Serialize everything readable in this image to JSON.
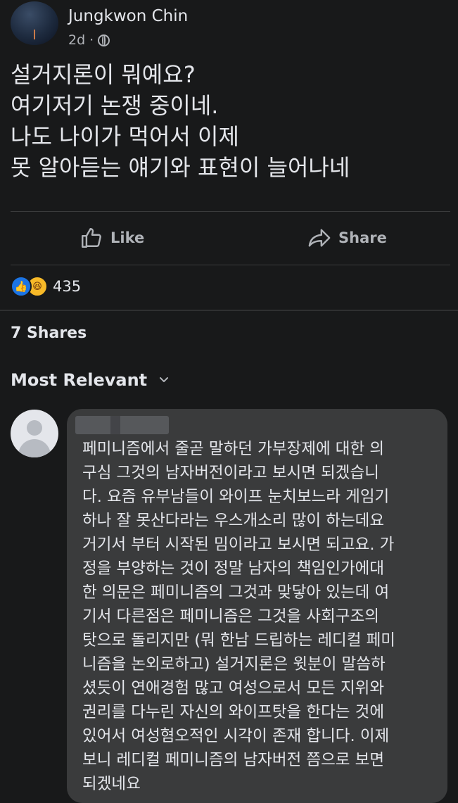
{
  "post": {
    "author": "Jungkwon Chin",
    "time": "2d",
    "privacy_icon": "globe-icon",
    "lines": [
      "설거지론이 뭐예요?",
      "여기저기 논쟁  중이네.",
      "나도 나이가 먹어서 이제",
      "못 알아듣는 얘기와 표현이 늘어나네"
    ]
  },
  "actions": {
    "like": "Like",
    "share": "Share"
  },
  "reactions": {
    "icons": [
      "like-icon",
      "haha-icon"
    ],
    "count": "435"
  },
  "shares": "7 Shares",
  "sort": {
    "label": "Most Relevant"
  },
  "comment": {
    "lines": [
      "페미니즘에서 줄곧 말하던 가부장제에 대한 의",
      "구심 그것의 남자버전이라고 보시면 되겠습니",
      "다. 요즘 유부남들이 와이프 눈치보느라 게임기",
      "하나 잘 못산다라는 우스개소리 많이 하는데요",
      "거기서 부터 시작된 밈이라고 보시면 되고요. 가",
      "정을 부양하는 것이 정말 남자의 책임인가에대",
      "한 의문은 페미니즘의 그것과 맞닿아 있는데 여",
      "기서 다른점은 페미니즘은 그것을 사회구조의",
      "탓으로 돌리지만 (뭐 한남 드립하는 레디컬 페미",
      "니즘을 논외로하고) 설거지론은 윗분이 말씀하",
      "셨듯이 연애경험 많고 여성으로서 모든 지위와",
      "권리를 다누린 자신의 와이프탓을 한다는 것에",
      "있어서 여성혐오적인 시각이 존재 합니다. 이제",
      "보니 레디컬 페미니즘의 남자버전 쯤으로 보면",
      "되겠네요"
    ]
  }
}
